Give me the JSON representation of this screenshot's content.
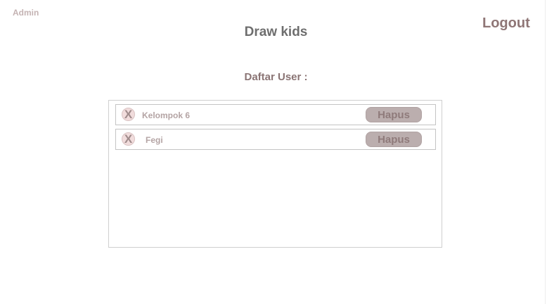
{
  "header": {
    "role": "Admin",
    "title": "Draw kids",
    "logout_label": "Logout"
  },
  "main": {
    "subtitle": "Daftar User :",
    "users": [
      {
        "name": "Kelompok 6",
        "remove_icon": "x-circle-icon",
        "remove_glyph": "X",
        "delete_label": "Hapus"
      },
      {
        "name": "Fegi",
        "remove_icon": "x-circle-icon",
        "remove_glyph": "X",
        "delete_label": "Hapus"
      }
    ]
  },
  "colors": {
    "accent": "#8f7676",
    "button": "#bbaeae"
  }
}
